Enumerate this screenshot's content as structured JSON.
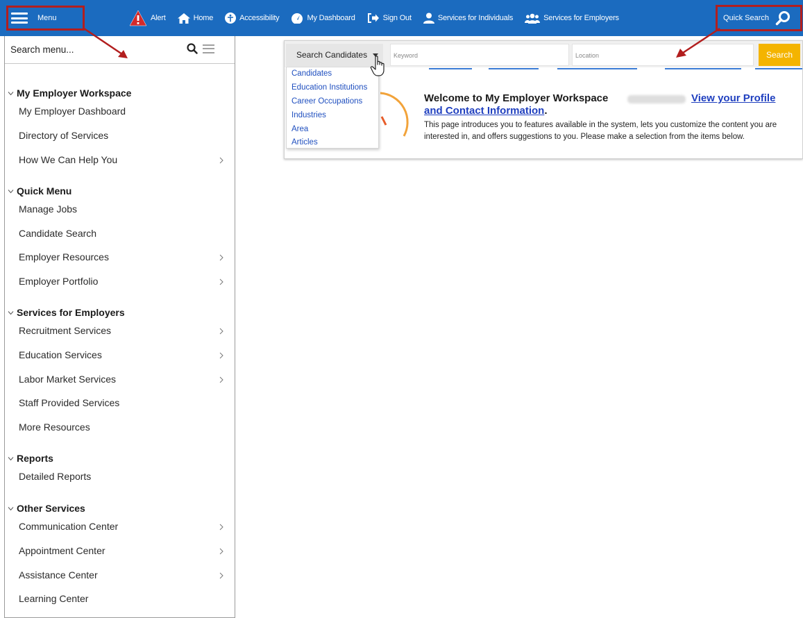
{
  "topbar": {
    "menu_label": "Menu",
    "nav": [
      {
        "label": "Alert",
        "icon": "alert-icon"
      },
      {
        "label": "Home",
        "icon": "home-icon"
      },
      {
        "label": "Accessibility",
        "icon": "accessibility-icon"
      },
      {
        "label": "My Dashboard",
        "icon": "dashboard-icon"
      },
      {
        "label": "Sign Out",
        "icon": "sign-out-icon"
      },
      {
        "label": "Services for Individuals",
        "icon": "person-icon"
      },
      {
        "label": "Services for Employers",
        "icon": "group-icon"
      }
    ],
    "quick_search_label": "Quick Search",
    "color": "#1b6bbf",
    "highlight_color": "#b21e1e"
  },
  "sidebar": {
    "search_placeholder": "Search menu...",
    "sections": [
      {
        "title": "My Employer Workspace",
        "items": [
          {
            "label": "My Employer Dashboard",
            "has_submenu": false
          },
          {
            "label": "Directory of Services",
            "has_submenu": false
          },
          {
            "label": "How We Can Help You",
            "has_submenu": true
          }
        ]
      },
      {
        "title": "Quick Menu",
        "items": [
          {
            "label": "Manage Jobs",
            "has_submenu": false
          },
          {
            "label": "Candidate Search",
            "has_submenu": false
          },
          {
            "label": "Employer Resources",
            "has_submenu": true
          },
          {
            "label": "Employer Portfolio",
            "has_submenu": true
          }
        ]
      },
      {
        "title": "Services for Employers",
        "items": [
          {
            "label": "Recruitment Services",
            "has_submenu": true
          },
          {
            "label": "Education Services",
            "has_submenu": true
          },
          {
            "label": "Labor Market Services",
            "has_submenu": true
          },
          {
            "label": "Staff Provided Services",
            "has_submenu": false
          },
          {
            "label": "More Resources",
            "has_submenu": false
          }
        ]
      },
      {
        "title": "Reports",
        "items": [
          {
            "label": "Detailed Reports",
            "has_submenu": false
          }
        ]
      },
      {
        "title": "Other Services",
        "items": [
          {
            "label": "Communication Center",
            "has_submenu": true
          },
          {
            "label": "Appointment Center",
            "has_submenu": true
          },
          {
            "label": "Assistance Center",
            "has_submenu": true
          },
          {
            "label": "Learning Center",
            "has_submenu": false
          }
        ]
      }
    ]
  },
  "quick_search": {
    "select_label": "Search Candidates",
    "keyword_placeholder": "Keyword",
    "location_placeholder": "Location",
    "search_button": "Search",
    "button_color": "#f4b400",
    "options": [
      "Candidates",
      "Education Institutions",
      "Career Occupations",
      "Industries",
      "Area",
      "Articles"
    ]
  },
  "welcome": {
    "title": "Welcome to My Employer Workspace",
    "link_part1": "View your Profile",
    "link_part2": "and Contact Information",
    "link_suffix": ".",
    "body": "This page introduces you to features available in the system, lets you customize the content you are interested in, and offers suggestions to you. Please make a selection from the items below."
  }
}
